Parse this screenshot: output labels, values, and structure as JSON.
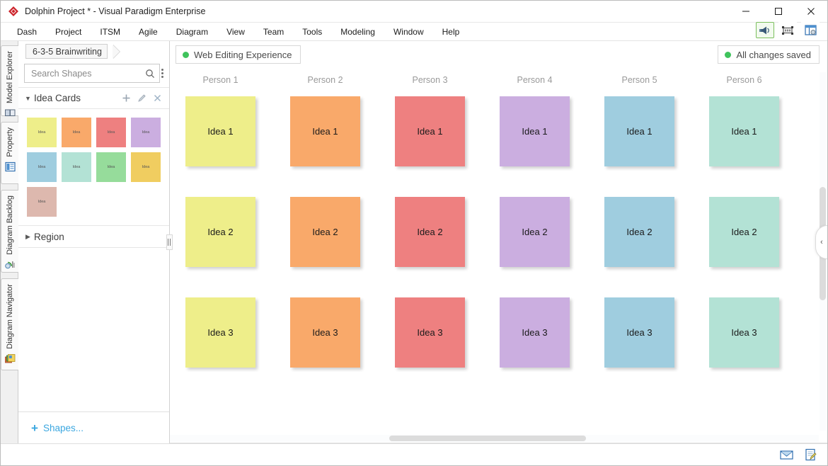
{
  "window": {
    "title": "Dolphin Project * - Visual Paradigm Enterprise",
    "logo_icon": "diamond-logo-icon",
    "minimize_icon": "minimize-icon",
    "maximize_icon": "maximize-icon",
    "close_icon": "close-icon"
  },
  "menu": {
    "items": [
      {
        "label": "Dash"
      },
      {
        "label": "Project"
      },
      {
        "label": "ITSM"
      },
      {
        "label": "Agile"
      },
      {
        "label": "Diagram"
      },
      {
        "label": "View"
      },
      {
        "label": "Team"
      },
      {
        "label": "Tools"
      },
      {
        "label": "Modeling"
      },
      {
        "label": "Window"
      },
      {
        "label": "Help"
      }
    ]
  },
  "vertical_tabs": [
    {
      "label": "Model Explorer",
      "icon": "model-explorer-icon"
    },
    {
      "label": "Property",
      "icon": "property-icon"
    },
    {
      "label": "Diagram Backlog",
      "icon": "diagram-backlog-icon"
    },
    {
      "label": "Diagram Navigator",
      "icon": "diagram-navigator-icon"
    }
  ],
  "breadcrumb": {
    "label": "6-3-5 Brainwriting"
  },
  "search": {
    "placeholder": "Search Shapes",
    "value": "",
    "icon": "search-icon",
    "menu_icon": "kebab-menu-icon"
  },
  "idea_cards_section": {
    "title": "Idea Cards",
    "expanded": true,
    "add_icon": "plus-icon",
    "edit_icon": "pencil-icon",
    "close_icon": "close-icon",
    "swatches": [
      {
        "label": "Idea",
        "color": "#eeee8a"
      },
      {
        "label": "Idea",
        "color": "#f9a96a"
      },
      {
        "label": "Idea",
        "color": "#ee8080"
      },
      {
        "label": "Idea",
        "color": "#cbaee0"
      },
      {
        "label": "Idea",
        "color": "#9fcddf"
      },
      {
        "label": "Idea",
        "color": "#b3e2d5"
      },
      {
        "label": "Idea",
        "color": "#96dc9b"
      },
      {
        "label": "Idea",
        "color": "#f0cd60"
      },
      {
        "label": "Idea",
        "color": "#ddb8ae"
      }
    ]
  },
  "region_section": {
    "title": "Region",
    "expanded": false
  },
  "shapes_footer": {
    "plus": "+",
    "label": "Shapes..."
  },
  "toolbar": {
    "buttons": [
      {
        "icon": "megaphone-icon",
        "selected": true
      },
      {
        "icon": "fit-to-screen-icon",
        "selected": false
      },
      {
        "icon": "panel-layout-icon",
        "selected": false
      }
    ]
  },
  "canvas": {
    "mode_badge": "Web Editing Experience",
    "mode_badge_dot_color": "#3fc35c",
    "save_status": "All changes saved",
    "save_status_dot_color": "#3fc35c",
    "columns": [
      {
        "header": "Person 1",
        "color": "#eeee8a",
        "cards": [
          "Idea 1",
          "Idea 2",
          "Idea 3"
        ]
      },
      {
        "header": "Person 2",
        "color": "#f9a96a",
        "cards": [
          "Idea 1",
          "Idea 2",
          "Idea 3"
        ]
      },
      {
        "header": "Person 3",
        "color": "#ee8080",
        "cards": [
          "Idea 1",
          "Idea 2",
          "Idea 3"
        ]
      },
      {
        "header": "Person 4",
        "color": "#cbaee0",
        "cards": [
          "Idea 1",
          "Idea 2",
          "Idea 3"
        ]
      },
      {
        "header": "Person 5",
        "color": "#9fcddf",
        "cards": [
          "Idea 1",
          "Idea 2",
          "Idea 3"
        ]
      },
      {
        "header": "Person 6",
        "color": "#b3e2d5",
        "cards": [
          "Idea 1",
          "Idea 2",
          "Idea 3"
        ]
      }
    ],
    "collapse_icon": "chevron-left-icon"
  },
  "statusbar": {
    "icons": [
      {
        "icon": "mail-icon"
      },
      {
        "icon": "note-edit-icon"
      }
    ]
  }
}
